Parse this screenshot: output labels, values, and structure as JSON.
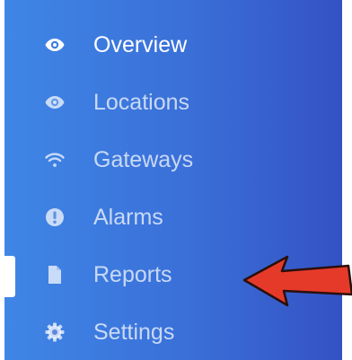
{
  "nav": {
    "items": [
      {
        "label": "Overview",
        "icon": "eye-icon"
      },
      {
        "label": "Locations",
        "icon": "eye-icon"
      },
      {
        "label": "Gateways",
        "icon": "wifi-icon"
      },
      {
        "label": "Alarms",
        "icon": "alert-circle-icon"
      },
      {
        "label": "Reports",
        "icon": "file-icon"
      },
      {
        "label": "Settings",
        "icon": "gear-icon"
      }
    ]
  },
  "colors": {
    "sidebar_gradient_start": "#3f86e6",
    "sidebar_gradient_end": "#3452c4",
    "annotation_arrow": "#e53a2a"
  }
}
